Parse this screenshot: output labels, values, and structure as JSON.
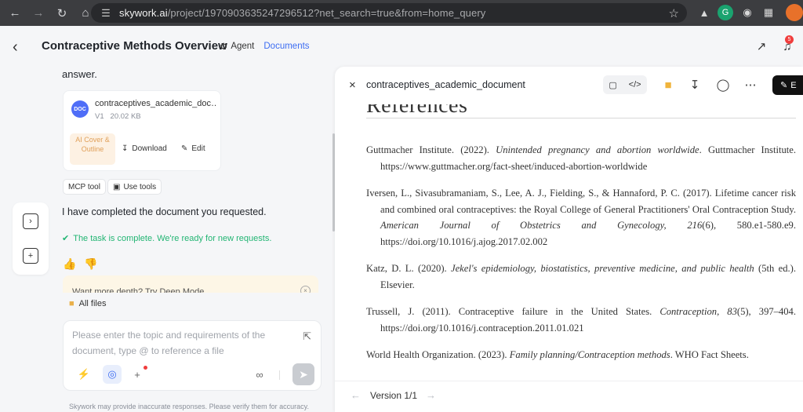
{
  "browser": {
    "url_host": "skywork.ai",
    "url_path": "/project/197090363524729651​2?net_search=true&from=home_query",
    "extension_icons": [
      "drive-icon",
      "grammarly-icon",
      "camera-icon",
      "puzzle-icon",
      "download-icon"
    ]
  },
  "header": {
    "title": "Contraceptive Methods Overview",
    "agent_label": "Agent",
    "documents_label": "Documents",
    "notification_count": "5"
  },
  "chat": {
    "answer_text": "answer.",
    "doc_card": {
      "badge": "DOC",
      "name": "contraceptives_academic_doc…",
      "version": "V1",
      "size": "20.02 KB",
      "ai_cover": "AI Cover & Outline",
      "download": "Download",
      "edit": "Edit"
    },
    "tools": {
      "mcp": "MCP tool",
      "use": "Use tools"
    },
    "completed_text": "I have completed the document you requested.",
    "task_status": "The task is complete. We're ready for new requests.",
    "deep_mode_text": "Want more depth? Try Deep Mode",
    "all_files": "All files",
    "input_placeholder": "Please enter the topic and requirements of the document, type @ to reference a file",
    "disclaimer": "Skywork may provide inaccurate responses. Please verify them for accuracy."
  },
  "panel": {
    "title": "contraceptives_academic_document",
    "edit_label": "E",
    "heading_fragment": "References",
    "references": [
      {
        "pre": "Guttmacher Institute. (2022). ",
        "italic": "Unintended pregnancy and abortion worldwide",
        "post": ". Guttmacher Institute. https://www.guttmacher.org/fact-sheet/induced-abortion-worldwide"
      },
      {
        "pre": "Iversen, L., Sivasubramaniam, S., Lee, A. J., Fielding, S., & Hannaford, P. C. (2017). Lifetime cancer risk and combined oral contraceptives: the Royal College of General Practitioners' Oral Contraception Study. ",
        "italic": "American Journal of Obstetrics and Gynecology, 216",
        "post": "(6), 580.e1-580.e9. https://doi.org/10.1016/j.ajog.2017.02.002"
      },
      {
        "pre": "Katz, D. L. (2020). ",
        "italic": "Jekel's epidemiology, biostatistics, preventive medicine, and public health",
        "post": " (5th ed.). Elsevier."
      },
      {
        "pre": "Trussell, J. (2011). Contraceptive failure in the United States. ",
        "italic": "Contraception, 83",
        "post": "(5), 397–404. https://doi.org/10.1016/j.contraception.2011.01.021"
      },
      {
        "pre": "World Health Organization. (2023). ",
        "italic": "Family planning/Contraception methods",
        "post": ". WHO Fact Sheets."
      }
    ],
    "version": "Version 1/1"
  }
}
